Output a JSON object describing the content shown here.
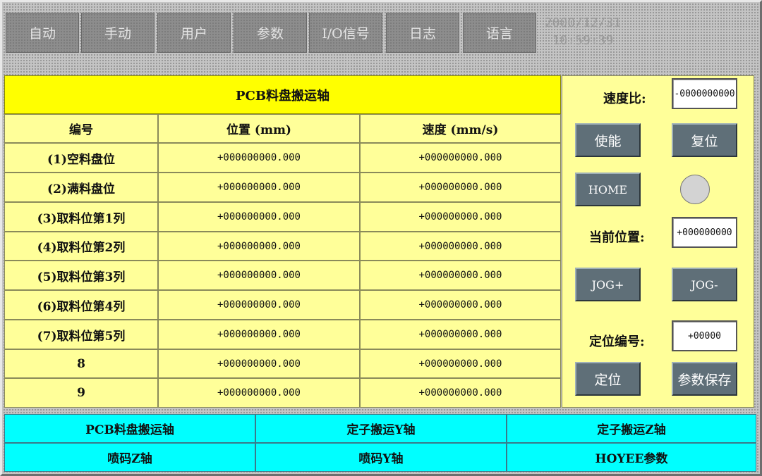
{
  "top_nav": {
    "items": [
      {
        "label": "自动"
      },
      {
        "label": "手动"
      },
      {
        "label": "用户"
      },
      {
        "label": "参数"
      },
      {
        "label": "I/O信号"
      },
      {
        "label": "日志"
      },
      {
        "label": "语言"
      }
    ],
    "date": "2000/12/31",
    "time": "10:59:39"
  },
  "axis_table": {
    "title": "PCB料盘搬运轴",
    "headers": {
      "id": "编号",
      "position": "位置 (mm)",
      "speed": "速度 (mm/s)"
    },
    "rows": [
      {
        "label": "(1)空料盘位",
        "position": "+000000000.000",
        "speed": "+000000000.000"
      },
      {
        "label": "(2)满料盘位",
        "position": "+000000000.000",
        "speed": "+000000000.000"
      },
      {
        "label": "(3)取料位第1列",
        "position": "+000000000.000",
        "speed": "+000000000.000"
      },
      {
        "label": "(4)取料位第2列",
        "position": "+000000000.000",
        "speed": "+000000000.000"
      },
      {
        "label": "(5)取料位第3列",
        "position": "+000000000.000",
        "speed": "+000000000.000"
      },
      {
        "label": "(6)取料位第4列",
        "position": "+000000000.000",
        "speed": "+000000000.000"
      },
      {
        "label": "(7)取料位第5列",
        "position": "+000000000.000",
        "speed": "+000000000.000"
      },
      {
        "label": "8",
        "position": "+000000000.000",
        "speed": "+000000000.000"
      },
      {
        "label": "9",
        "position": "+000000000.000",
        "speed": "+000000000.000"
      }
    ]
  },
  "control_panel": {
    "speed_ratio_label": "速度比:",
    "speed_ratio_value": "-0000000000",
    "enable_label": "使能",
    "reset_label": "复位",
    "home_label": "HOME",
    "home_indicator_color": "#d3d3d3",
    "current_position_label": "当前位置:",
    "current_position_value": "+000000000",
    "jog_plus_label": "JOG+",
    "jog_minus_label": "JOG-",
    "position_number_label": "定位编号:",
    "position_number_value": "+00000",
    "locate_label": "定位",
    "save_params_label": "参数保存"
  },
  "bottom_nav": {
    "items": [
      {
        "label": "PCB料盘搬运轴"
      },
      {
        "label": "定子搬运Y轴"
      },
      {
        "label": "定子搬运Z轴"
      },
      {
        "label": "喷码Z轴"
      },
      {
        "label": "喷码Y轴"
      },
      {
        "label": "HOYEE参数"
      }
    ]
  },
  "colors": {
    "title_bar": "#ffff00",
    "table_bg": "#ffff99",
    "nav_button": "#8d8d8d",
    "action_button": "#5f6f78",
    "bottom_nav": "#00ffff"
  }
}
